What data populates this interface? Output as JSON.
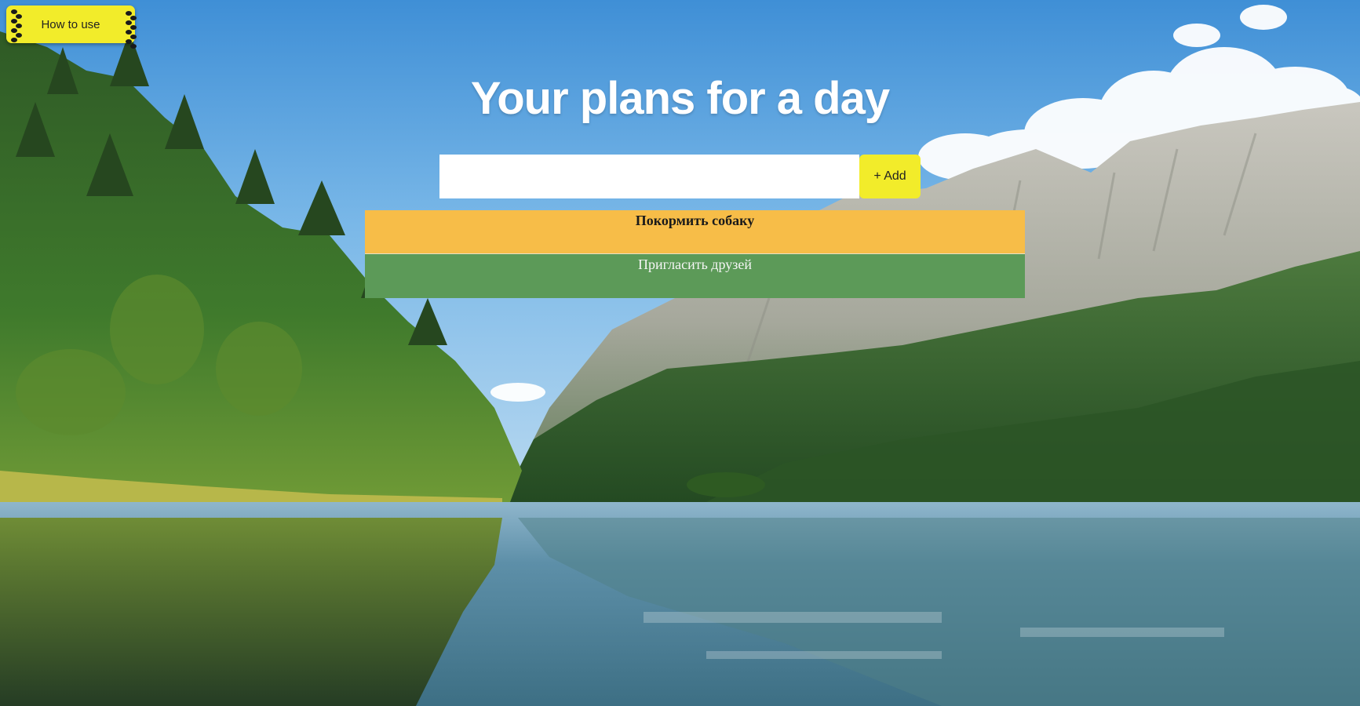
{
  "colors": {
    "accent_yellow": "#f2ec2a",
    "task_done_bg": "#f7bd48",
    "task_open_bg": "#5c9a58"
  },
  "help_button": {
    "label": "How to use"
  },
  "header": {
    "title": "Your plans for a day"
  },
  "new_task": {
    "value": "",
    "placeholder": "",
    "add_label": "+ Add"
  },
  "tasks": [
    {
      "text": "Покормить собаку",
      "done": true
    },
    {
      "text": "Пригласить друзей",
      "done": false
    }
  ]
}
